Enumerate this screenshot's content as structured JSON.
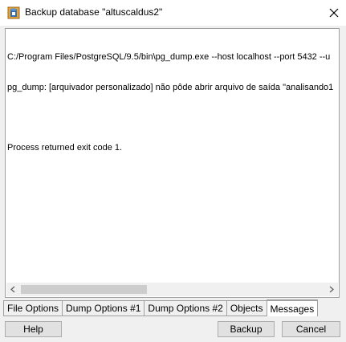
{
  "window": {
    "title": "Backup database \"altuscaldus2\"",
    "icon": "pgadmin-backup-icon",
    "close_icon": "close-icon"
  },
  "messages": {
    "lines": [
      "C:/Program Files/PostgreSQL/9.5/bin\\pg_dump.exe --host localhost --port 5432 --u",
      "pg_dump: [arquivador personalizado] não pôde abrir arquivo de saída \"analisando1",
      "",
      "Process returned exit code 1."
    ]
  },
  "tabs": [
    {
      "label": "File Options",
      "active": false
    },
    {
      "label": "Dump Options #1",
      "active": false
    },
    {
      "label": "Dump Options #2",
      "active": false
    },
    {
      "label": "Objects",
      "active": false
    },
    {
      "label": "Messages",
      "active": true
    }
  ],
  "buttons": {
    "help": "Help",
    "backup": "Backup",
    "cancel": "Cancel"
  },
  "colors": {
    "window_bg": "#f0f0f0",
    "titlebar_bg": "#ffffff",
    "border": "#a0a0a0",
    "button_bg": "#e1e1e1"
  }
}
